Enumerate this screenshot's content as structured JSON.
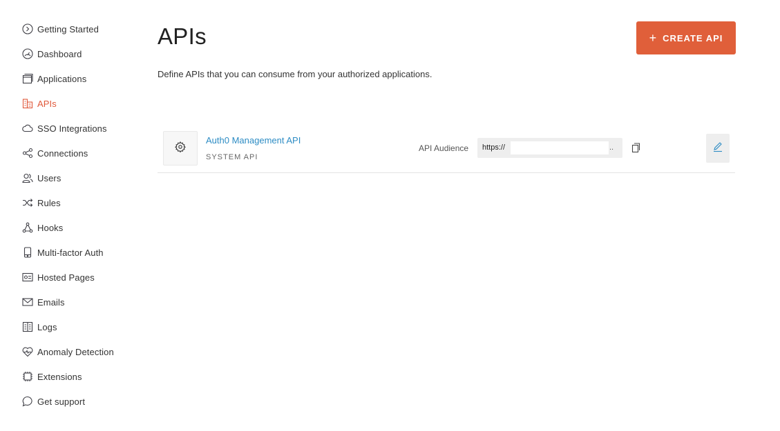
{
  "sidebar": {
    "items": [
      {
        "label": "Getting Started",
        "icon": "play-circle-icon",
        "active": false
      },
      {
        "label": "Dashboard",
        "icon": "gauge-icon",
        "active": false
      },
      {
        "label": "Applications",
        "icon": "windows-icon",
        "active": false
      },
      {
        "label": "APIs",
        "icon": "buildings-icon",
        "active": true
      },
      {
        "label": "SSO Integrations",
        "icon": "cloud-icon",
        "active": false
      },
      {
        "label": "Connections",
        "icon": "share-nodes-icon",
        "active": false
      },
      {
        "label": "Users",
        "icon": "users-icon",
        "active": false
      },
      {
        "label": "Rules",
        "icon": "shuffle-icon",
        "active": false
      },
      {
        "label": "Hooks",
        "icon": "hook-nodes-icon",
        "active": false
      },
      {
        "label": "Multi-factor Auth",
        "icon": "phone-icon",
        "active": false
      },
      {
        "label": "Hosted Pages",
        "icon": "browser-page-icon",
        "active": false
      },
      {
        "label": "Emails",
        "icon": "envelope-icon",
        "active": false
      },
      {
        "label": "Logs",
        "icon": "log-book-icon",
        "active": false
      },
      {
        "label": "Anomaly Detection",
        "icon": "heart-pulse-icon",
        "active": false
      },
      {
        "label": "Extensions",
        "icon": "chip-icon",
        "active": false
      },
      {
        "label": "Get support",
        "icon": "chat-bubble-icon",
        "active": false
      }
    ]
  },
  "header": {
    "title": "APIs",
    "subtitle": "Define APIs that you can consume from your authorized applications.",
    "create_button": "CREATE API"
  },
  "apis": [
    {
      "name": "Auth0 Management API",
      "type": "SYSTEM API",
      "audience_label": "API Audience",
      "audience_value": "https://",
      "audience_ellipsis": ".."
    }
  ],
  "colors": {
    "accent": "#e05f3a",
    "link": "#2d8cc4",
    "active_nav": "#e0583a"
  }
}
